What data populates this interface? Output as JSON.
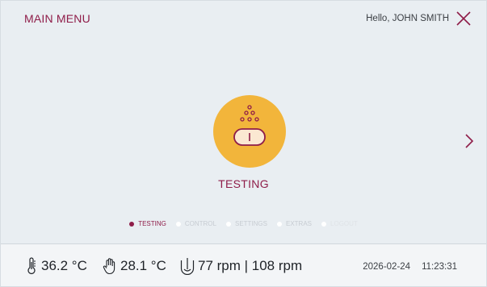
{
  "header": {
    "title": "MAIN MENU",
    "greeting": "Hello, JOHN SMITH",
    "close_icon": "close-icon"
  },
  "main": {
    "module_label": "TESTING",
    "module_icon": "testing-icon",
    "next_icon": "chevron-right-icon"
  },
  "pagination": {
    "items": [
      {
        "label": "TESTING",
        "state": "active"
      },
      {
        "label": "CONTROL",
        "state": "inactive"
      },
      {
        "label": "SETTINGS",
        "state": "inactive"
      },
      {
        "label": "EXTRAS",
        "state": "inactive"
      },
      {
        "label": "LOGOUT",
        "state": "disabled"
      }
    ]
  },
  "status": {
    "temperature": "36.2 °C",
    "hand_temperature": "28.1 °C",
    "speed": "77 rpm | 108 rpm",
    "date": "2026-02-24",
    "time": "11:23:31"
  },
  "colors": {
    "accent": "#8f1d49",
    "circle": "#f2b53b",
    "background": "#e9eef2"
  }
}
